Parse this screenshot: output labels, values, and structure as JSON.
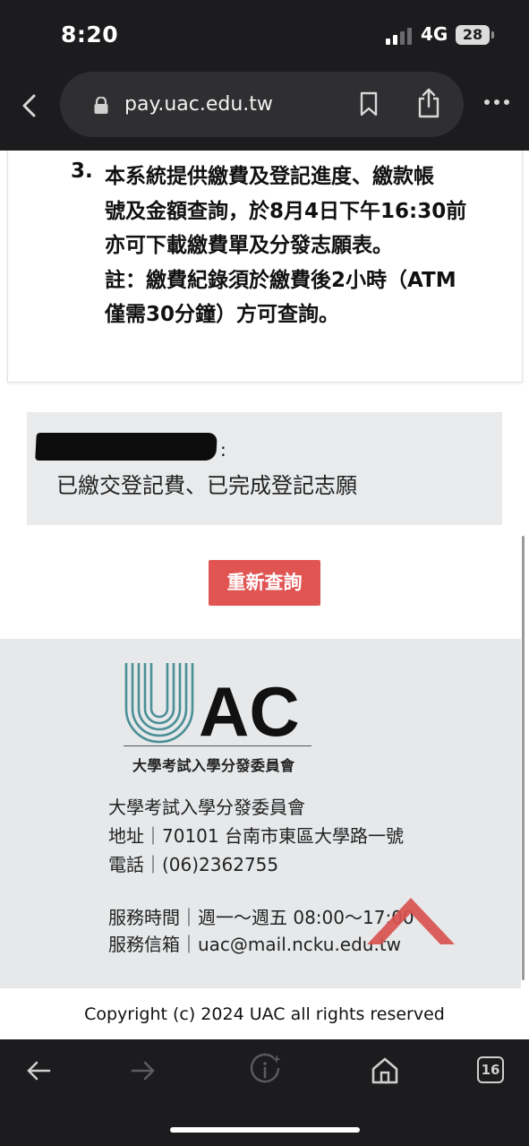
{
  "status_bar": {
    "time": "8:20",
    "network": "4G",
    "battery": "28"
  },
  "browser": {
    "url": "pay.uac.edu.tw",
    "tab_count": "16"
  },
  "notice": {
    "number": "3.",
    "lines": [
      "本系統提供繳費及登記進度、繳款帳",
      "號及金額查詢，於8月4日下午16:30前",
      "亦可下載繳費單及分發志願表。",
      "註：繳費紀錄須於繳費後2小時（ATM",
      "僅需30分鐘）方可查詢。"
    ]
  },
  "status_box": {
    "label_suffix": ":",
    "status_text": "已繳交登記費、已完成登記志願"
  },
  "requery_button": "重新查詢",
  "footer": {
    "logo_text": "AC",
    "logo_subtitle": "大學考試入學分發委員會",
    "org_name": "大學考試入學分發委員會",
    "address": "地址｜70101 台南市東區大學路一號",
    "phone": "電話｜(06)2362755",
    "hours": "服務時間｜週一～週五 08:00～17:00",
    "email": "服務信箱｜uac@mail.ncku.edu.tw",
    "copyright": "Copyright (c) 2024 UAC all rights reserved"
  },
  "colors": {
    "accent_red": "#e05452",
    "logo_teal": "#4a8f96",
    "footer_bg": "#e6e8ea",
    "status_box_bg": "#e8eaec"
  },
  "icons": [
    "back-icon",
    "lock-icon",
    "bookmark-icon",
    "share-icon",
    "more-icon",
    "scroll-top-icon",
    "toolbar-back-icon",
    "toolbar-forward-icon",
    "info-sparkle-icon",
    "home-icon",
    "tabs-icon"
  ]
}
